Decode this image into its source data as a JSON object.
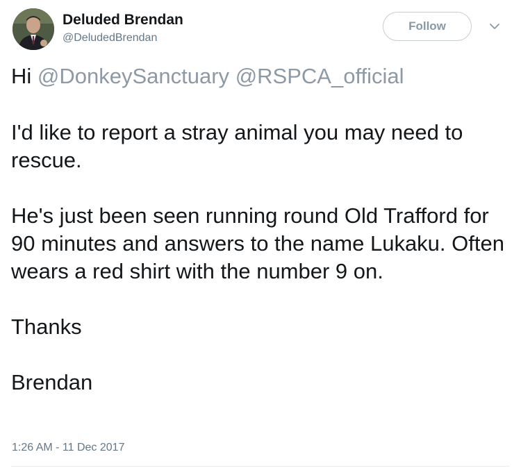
{
  "user": {
    "display_name": "Deluded Brendan",
    "handle": "@DeludedBrendan"
  },
  "actions": {
    "follow_label": "Follow",
    "menu_icon": "chevron-down-icon"
  },
  "tweet": {
    "greeting": "Hi",
    "mentions": [
      "@DonkeySanctuary",
      "@RSPCA_official"
    ],
    "paragraph_1": "I'd like to report a stray animal you may need to rescue.",
    "paragraph_2": "He's just been seen running round Old Trafford for 90 minutes and answers to the name Lukaku. Often wears a red shirt with the number 9 on.",
    "paragraph_3": "Thanks",
    "paragraph_4": "Brendan",
    "timestamp": "1:26 AM - 11 Dec 2017"
  },
  "colors": {
    "mention": "#8d9aa6",
    "text": "#14171a",
    "secondary": "#657786"
  }
}
